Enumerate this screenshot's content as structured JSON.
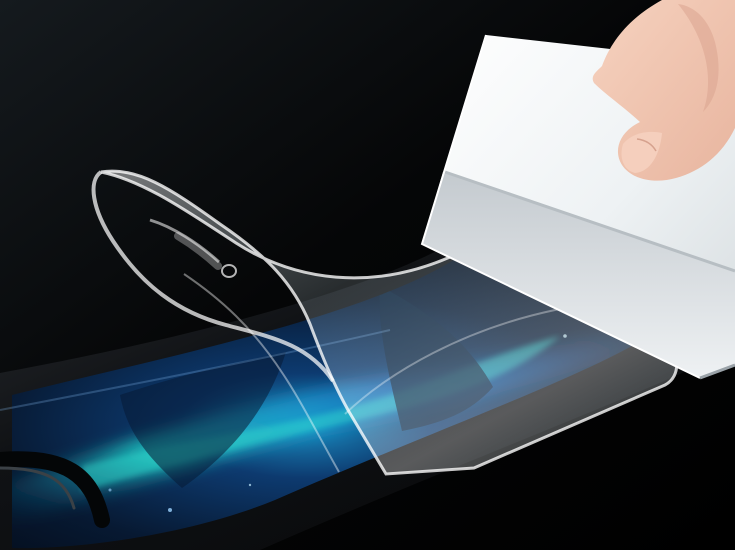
{
  "scene": {
    "subject": "screen-protector-film-application",
    "colors": {
      "background": "#050607",
      "phone_frame": "#111317",
      "screen_deep": "#06121f",
      "aurora_teal": "#29d2c5",
      "aurora_blue": "#1c6fc5",
      "film": "#d9f3ff",
      "card": "#eef2f4",
      "card_shadow": "#c7cdd1",
      "skin": "#f0c6b2"
    },
    "objects": [
      {
        "name": "phone",
        "icon": "smartphone-icon"
      },
      {
        "name": "protective-film",
        "icon": "film-sheet-icon"
      },
      {
        "name": "squeegee-card",
        "icon": "card-icon"
      },
      {
        "name": "hand",
        "icon": "hand-icon"
      }
    ]
  }
}
